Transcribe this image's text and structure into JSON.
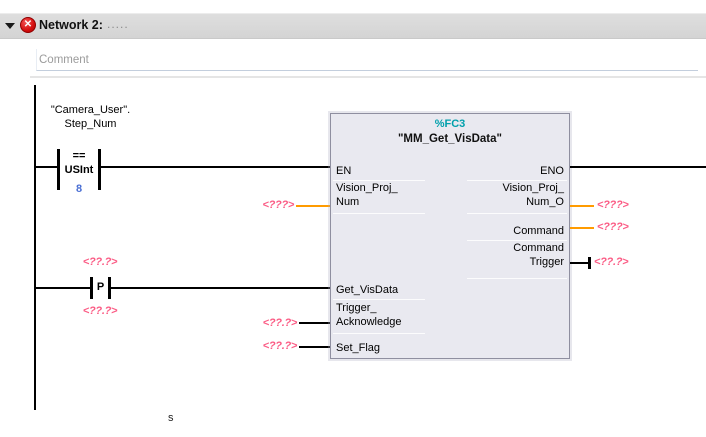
{
  "header": {
    "title": "Network 2:",
    "title_dots": ".....",
    "error_glyph": "✕"
  },
  "comment": {
    "placeholder": "Comment"
  },
  "rung1": {
    "operand_line1": "\"Camera_User\".",
    "operand_line2": "Step_Num",
    "compare_op": "==",
    "compare_type": "USInt",
    "compare_value": "8"
  },
  "rung2": {
    "operand_above": "<??.?>",
    "contact_label": "P",
    "operand_below": "<??.?>"
  },
  "block": {
    "address": "%FC3",
    "name": "\"MM_Get_VisData\"",
    "pins": {
      "en": "EN",
      "eno": "ENO",
      "vision_proj_num_l1": "Vision_Proj_",
      "vision_proj_num_l2": "Num",
      "vision_proj_num_o_l1": "Vision_Proj_",
      "vision_proj_num_o_l2": "Num_O",
      "command": "Command",
      "command_trigger_l1": "Command",
      "command_trigger_l2": "Trigger",
      "get_visdata": "Get_VisData",
      "trigger_ack_l1": "Trigger_",
      "trigger_ack_l2": "Acknowledge",
      "set_flag": "Set_Flag"
    },
    "operands": {
      "vision_proj_num_in": "<???>",
      "trigger_ack_in": "<??.?>",
      "set_flag_in": "<??.?>",
      "vision_proj_num_o_out": "<???>",
      "command_out": "<???>",
      "command_trigger_out": "<??.?>"
    }
  },
  "stray_text": "s",
  "colors": {
    "unconnected_pin_wire": "#ff9b00",
    "placeholder_pink": "#fb5c85",
    "address_teal": "#00a0ac",
    "constant_blue": "#4a6fd4",
    "error_red": "#d50f0f",
    "header_gray": "#d9d9d9"
  }
}
